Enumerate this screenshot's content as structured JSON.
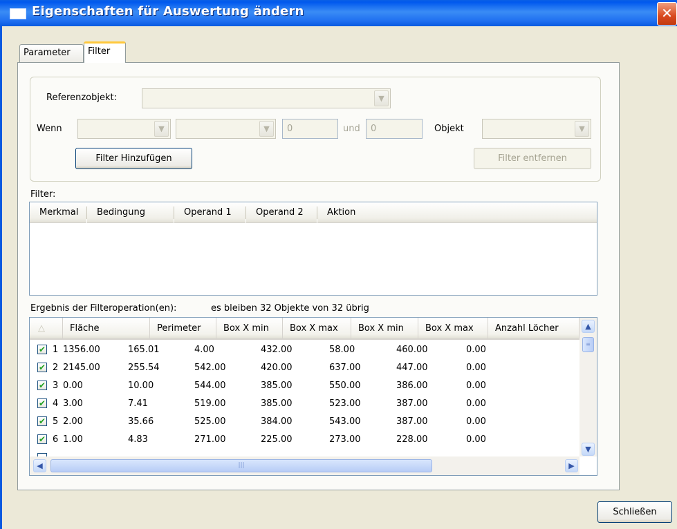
{
  "window": {
    "title": "Eigenschaften für Auswertung ändern",
    "close_glyph": "✕"
  },
  "tabs": [
    {
      "label": "Parameter",
      "selected": false
    },
    {
      "label": "Filter",
      "selected": true
    }
  ],
  "filter_form": {
    "reference_label": "Referenzobjekt:",
    "reference_value": "",
    "wenn_label": "Wenn",
    "wenn_field": "",
    "condition_value": "",
    "operand1_value": "0",
    "und_label": "und",
    "operand2_value": "0",
    "objekt_label": "Objekt",
    "objekt_value": "",
    "add_button": "Filter Hinzufügen",
    "remove_button": "Filter entfernen"
  },
  "filter_list": {
    "label": "Filter:",
    "columns": [
      "Merkmal",
      "Bedingung",
      "Operand 1",
      "Operand 2",
      "Aktion"
    ]
  },
  "result": {
    "label": "Ergebnis der Filteroperation(en):",
    "summary": "es bleiben 32 Objekte von 32 übrig",
    "sort_glyph": "△",
    "columns": [
      "Fläche",
      "Perimeter",
      "Box X min",
      "Box X max",
      "Box X min",
      "Box X max",
      "Anzahl Löcher"
    ],
    "rows": [
      {
        "idx": "1",
        "checked": true,
        "values": [
          "1356.00",
          "165.01",
          "4.00",
          "432.00",
          "58.00",
          "460.00",
          "0.00"
        ]
      },
      {
        "idx": "2",
        "checked": true,
        "values": [
          "2145.00",
          "255.54",
          "542.00",
          "420.00",
          "637.00",
          "447.00",
          "0.00"
        ]
      },
      {
        "idx": "3",
        "checked": true,
        "values": [
          "0.00",
          "10.00",
          "544.00",
          "385.00",
          "550.00",
          "386.00",
          "0.00"
        ]
      },
      {
        "idx": "4",
        "checked": true,
        "values": [
          "3.00",
          "7.41",
          "519.00",
          "385.00",
          "523.00",
          "387.00",
          "0.00"
        ]
      },
      {
        "idx": "5",
        "checked": true,
        "values": [
          "2.00",
          "35.66",
          "525.00",
          "384.00",
          "543.00",
          "387.00",
          "0.00"
        ]
      },
      {
        "idx": "6",
        "checked": true,
        "values": [
          "1.00",
          "4.83",
          "271.00",
          "225.00",
          "273.00",
          "228.00",
          "0.00"
        ]
      }
    ]
  },
  "scroll": {
    "up": "▲",
    "down": "▼",
    "left": "◀",
    "right": "▶",
    "grip": "|||",
    "vgrip": "≡"
  },
  "footer": {
    "close_button": "Schließen"
  },
  "colors": {
    "title_bar": "#0058EE",
    "window_bg": "#ECE9D8",
    "checkmark": "#21A121",
    "close_button": "#D94A1E"
  }
}
